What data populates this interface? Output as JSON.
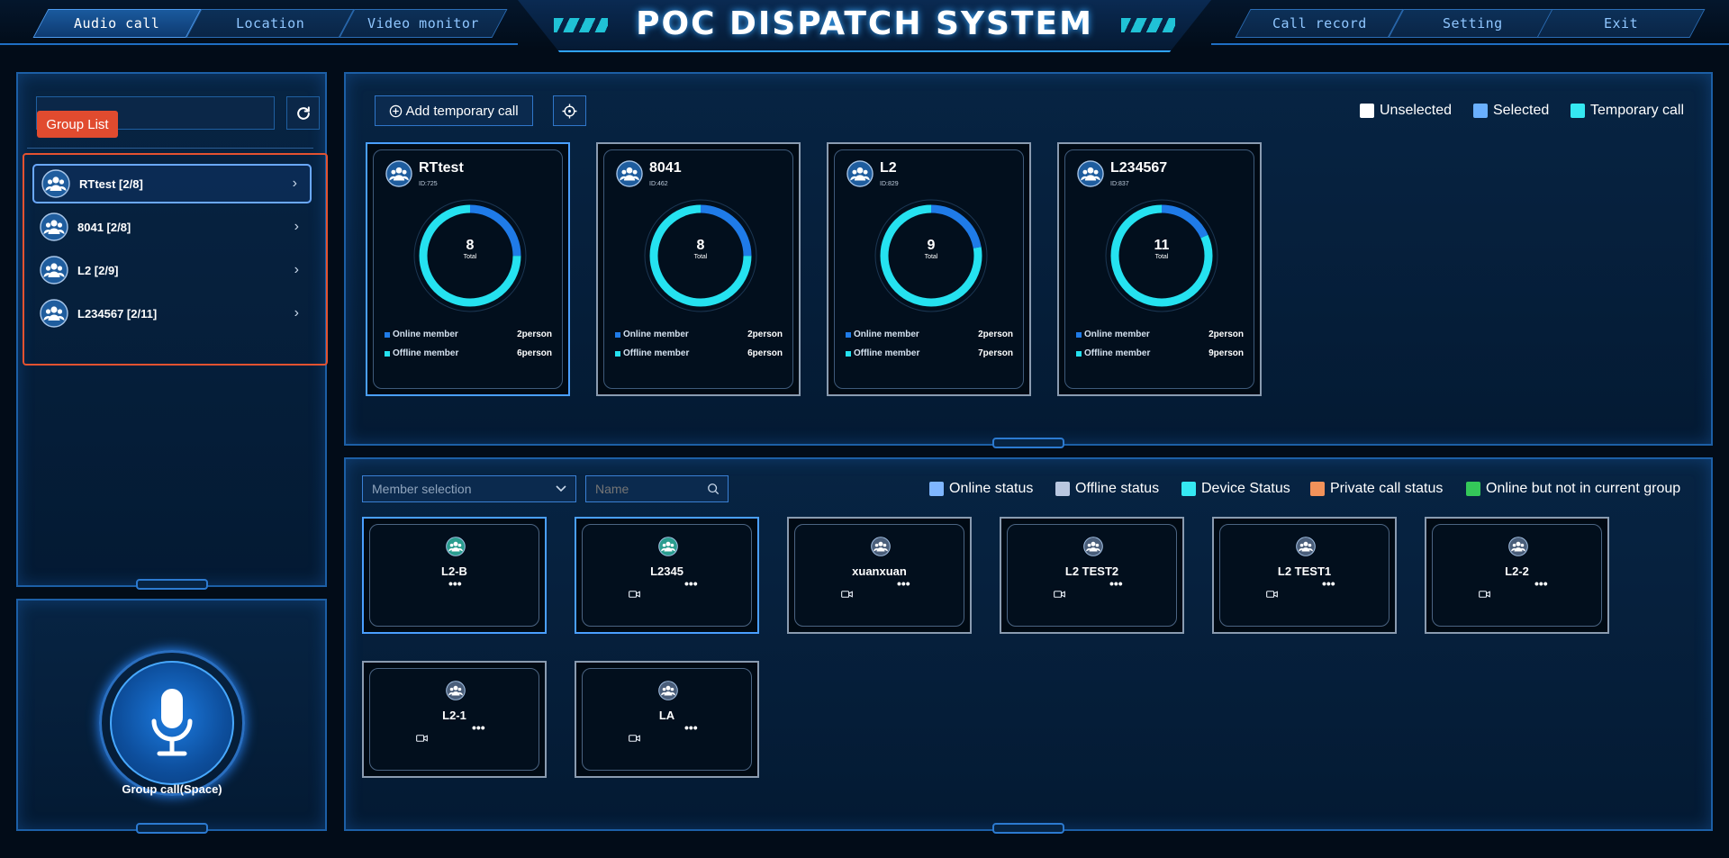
{
  "app_title": "POC DISPATCH SYSTEM",
  "nav": {
    "audio_call": "Audio call",
    "location": "Location",
    "video_monitor": "Video monitor",
    "call_record": "Call record",
    "setting": "Setting",
    "exit": "Exit"
  },
  "sidebar": {
    "tag": "Group List",
    "search_placeholder": "",
    "groups": [
      {
        "label": "RTtest [2/8]"
      },
      {
        "label": "8041 [2/8]"
      },
      {
        "label": "L2 [2/9]"
      },
      {
        "label": "L234567 [2/11]"
      }
    ],
    "group_call_label": "Group call(Space)"
  },
  "groups_panel": {
    "add_temp_call": "Add temporary call",
    "legend": {
      "unselected": "Unselected",
      "selected": "Selected",
      "temporary": "Temporary call"
    },
    "colors": {
      "unselected": "#ffffff",
      "selected": "#6ab0ff",
      "temporary": "#35e8f2"
    },
    "online_label": "Online member",
    "offline_label": "Offline member",
    "total_label": "Total",
    "cards": [
      {
        "name": "RTtest",
        "id": "ID:725",
        "total": "8",
        "online": "2person",
        "offline": "6person",
        "online_ratio": 0.25
      },
      {
        "name": "8041",
        "id": "ID:462",
        "total": "8",
        "online": "2person",
        "offline": "6person",
        "online_ratio": 0.25
      },
      {
        "name": "L2",
        "id": "ID:829",
        "total": "9",
        "online": "2person",
        "offline": "7person",
        "online_ratio": 0.222
      },
      {
        "name": "L234567",
        "id": "ID:837",
        "total": "11",
        "online": "2person",
        "offline": "9person",
        "online_ratio": 0.182
      }
    ]
  },
  "members_panel": {
    "member_select": "Member selection",
    "name_placeholder": "Name",
    "legend": {
      "online": "Online status",
      "offline": "Offline status",
      "device": "Device Status",
      "private": "Private call status",
      "not_in_group": "Online but not in current group"
    },
    "legend_colors": {
      "online": "#7fb6ff",
      "offline": "#b9c7e0",
      "device": "#35e8f2",
      "private": "#f2925a",
      "not_in_group": "#34c759"
    },
    "more": "•••",
    "members": [
      {
        "name": "L2-B",
        "online": true,
        "camera": false
      },
      {
        "name": "L2345",
        "online": true,
        "camera": true
      },
      {
        "name": "xuanxuan",
        "online": false,
        "camera": true
      },
      {
        "name": "L2 TEST2",
        "online": false,
        "camera": true
      },
      {
        "name": "L2 TEST1",
        "online": false,
        "camera": true
      },
      {
        "name": "L2-2",
        "online": false,
        "camera": true
      },
      {
        "name": "L2-1",
        "online": false,
        "camera": true
      },
      {
        "name": "LA",
        "online": false,
        "camera": true
      }
    ]
  }
}
